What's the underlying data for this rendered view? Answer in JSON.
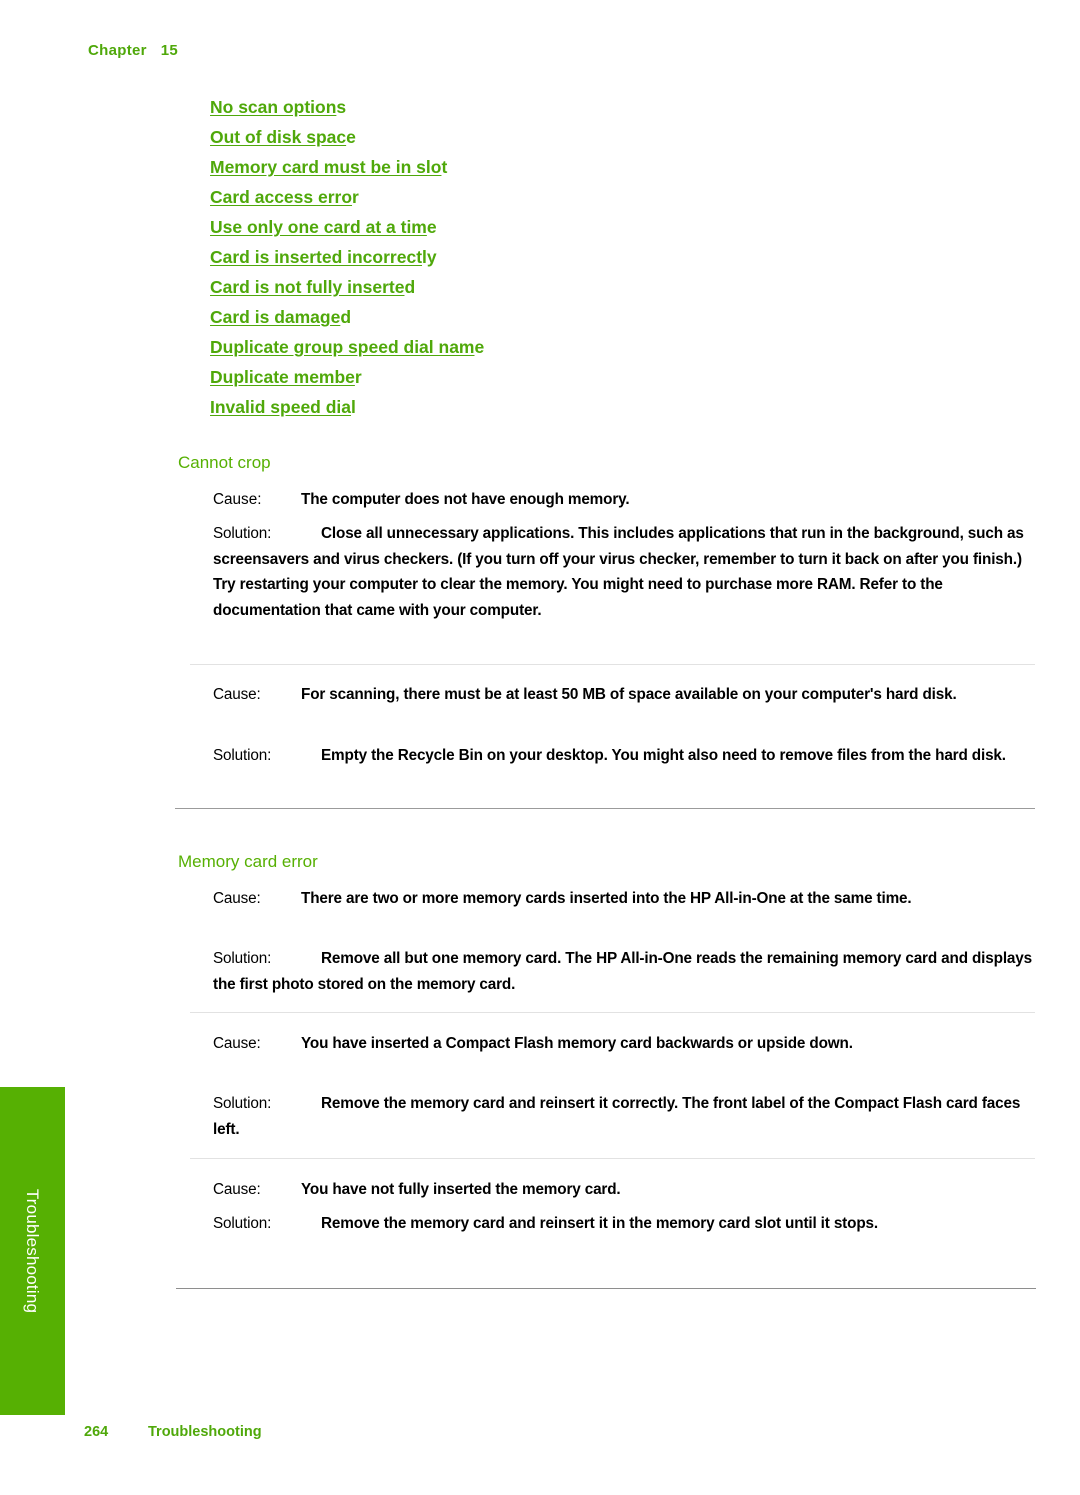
{
  "header": {
    "chapter_label": "Chapter",
    "chapter_number": "15"
  },
  "links": [
    {
      "text": "No scan options",
      "underline": "No scan option"
    },
    {
      "text": "Out of disk space",
      "underline": "Out of disk spac"
    },
    {
      "text": "Memory card must be in slot",
      "underline": "Memory card must be in slo"
    },
    {
      "text": "Card access error",
      "underline": "Card access erro"
    },
    {
      "text": "Use only one card at a time",
      "underline": "Use only one card at a tim"
    },
    {
      "text": "Card is inserted incorrectly",
      "underline": "Card is inserted incorrect"
    },
    {
      "text": "Card is not fully inserted",
      "underline": "Card is not fully inserte"
    },
    {
      "text": "Card is damaged",
      "underline": "Card is damage"
    },
    {
      "text": "Duplicate group speed dial name",
      "underline": "Duplicate group speed dial nam"
    },
    {
      "text": "Duplicate member",
      "underline": "Duplicate membe"
    },
    {
      "text": "Invalid speed dial",
      "underline": "Invalid speed dia"
    }
  ],
  "sections": [
    {
      "title": "Cannot crop",
      "blocks": [
        {
          "cause_label": "Cause:",
          "cause_text": "The computer does not have enough memory.",
          "solution_label": "Solution:",
          "solution_text": "Close all unnecessary applications. This includes applications that run in the background, such as screensavers and virus checkers. (If you turn off your virus checker, remember to turn it back on after you finish.) Try restarting your computer to clear the memory. You might need to purchase more RAM. Refer to the documentation that came with your computer."
        },
        {
          "cause_label": "Cause:",
          "cause_text": "For scanning, there must be at least 50 MB of space available on your computer's hard disk.",
          "solution_label": "Solution:",
          "solution_text": "Empty the Recycle Bin on your desktop. You might also need to remove files from the hard disk."
        }
      ]
    },
    {
      "title": "Memory card error",
      "blocks": [
        {
          "cause_label": "Cause:",
          "cause_text": "There are two or more memory cards inserted into the HP All-in-One at the same time.",
          "solution_label": "Solution:",
          "solution_text": "Remove all but one memory card. The HP All-in-One reads the remaining memory card and displays the first photo stored on the memory card."
        },
        {
          "cause_label": "Cause:",
          "cause_text": "You have inserted a Compact Flash memory card backwards or upside down.",
          "solution_label": "Solution:",
          "solution_text": "Remove the memory card and reinsert it correctly. The front label of the Compact Flash card faces left."
        },
        {
          "cause_label": "Cause:",
          "cause_text": "You have not fully inserted the memory card.",
          "solution_label": "Solution:",
          "solution_text": "Remove the memory card and reinsert it in the memory card slot until it stops."
        }
      ]
    }
  ],
  "side_tab": {
    "label": "Troubleshooting"
  },
  "footer": {
    "page_number": "264",
    "section_name": "Troubleshooting"
  },
  "colors": {
    "brand_green": "#56b003",
    "link_green": "#4fa80a",
    "rule_light": "#e2e2e2",
    "rule_heavy": "#9b9b9b"
  }
}
